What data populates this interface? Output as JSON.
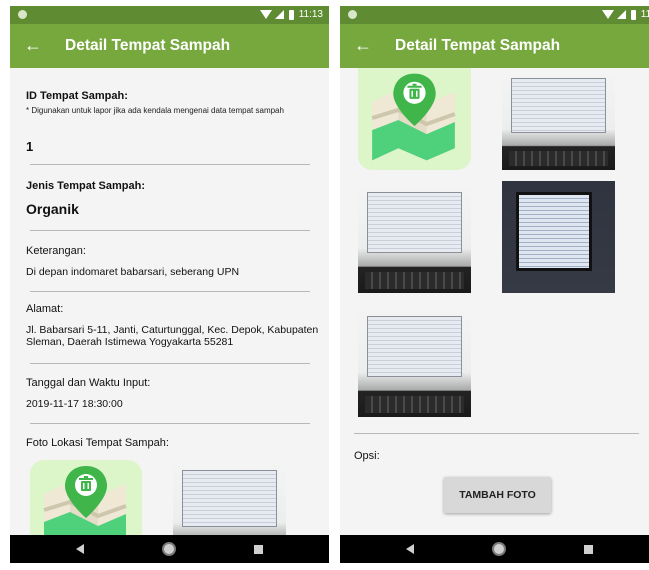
{
  "status_bar": {
    "time": "11:13"
  },
  "app_bar": {
    "title": "Detail Tempat Sampah"
  },
  "detail": {
    "id_label": "ID Tempat Sampah:",
    "id_hint": "* Digunakan untuk lapor jika ada kendala mengenai data tempat sampah",
    "id_value": "1",
    "type_label": "Jenis Tempat Sampah:",
    "type_value": "Organik",
    "notes_label": "Keterangan:",
    "notes_value": "Di depan indomaret babarsari, seberang UPN",
    "address_label": "Alamat:",
    "address_value": "Jl. Babarsari 5-11, Janti, Caturtunggal, Kec. Depok, Kabupaten Sleman, Daerah Istimewa Yogyakarta 55281",
    "datetime_label": "Tanggal dan Waktu Input:",
    "datetime_value": "2019-11-17 18:30:00",
    "photos_label": "Foto Lokasi Tempat Sampah:"
  },
  "photos_screen": {
    "options_label": "Opsi:",
    "add_photo_button": "TAMBAH FOTO"
  },
  "icons": [
    "back-arrow-icon",
    "trash-map-pin-icon",
    "wifi-icon",
    "signal-icon",
    "battery-icon",
    "nav-back-icon",
    "nav-home-icon",
    "nav-recent-icon"
  ],
  "colors": {
    "status_bar": "#5f8b32",
    "app_bar": "#76a83e",
    "pin_green": "#3fb54a",
    "icon_bg": "#dcf5c9"
  }
}
